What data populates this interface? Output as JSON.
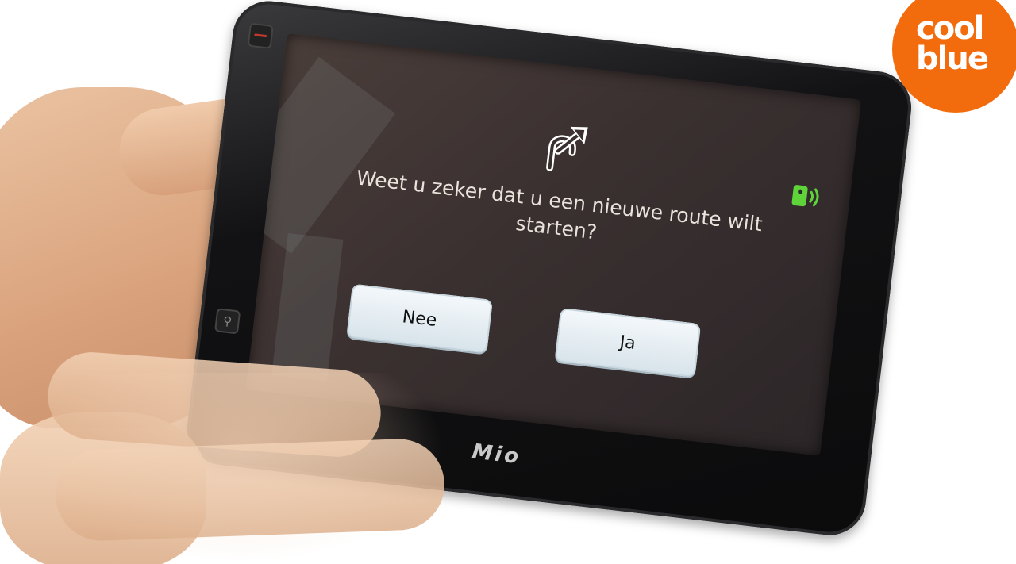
{
  "brand": {
    "line1": "cool",
    "line2": "blue",
    "color": "#f26c0d"
  },
  "device": {
    "maker_logo": "Mio",
    "buttons": [
      "power-button",
      "pin-button"
    ]
  },
  "dialog": {
    "icon": "route-detour-icon",
    "gps_icon": "gps-signal-icon",
    "gps_color": "#5fd33a",
    "question": "Weet u zeker dat u een nieuwe route wilt starten?",
    "no_label": "Nee",
    "yes_label": "Ja"
  }
}
